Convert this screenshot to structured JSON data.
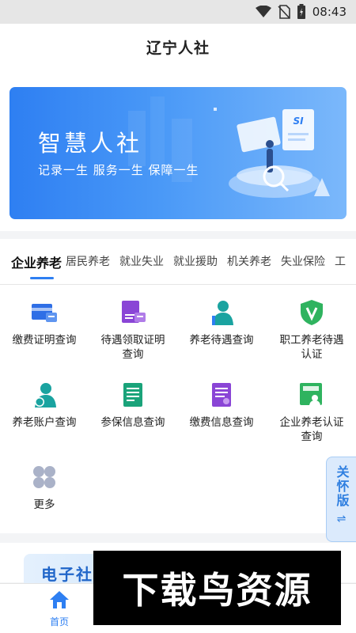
{
  "status_bar": {
    "time": "08:43",
    "icons": [
      "wifi-icon",
      "no-sim-icon",
      "battery-icon"
    ]
  },
  "header": {
    "title": "辽宁人社"
  },
  "banner": {
    "title": "智慧人社",
    "subtitle": "记录一生  服务一生  保障一生",
    "badge_text": "SI"
  },
  "tabs": [
    {
      "label": "企业养老",
      "active": true
    },
    {
      "label": "居民养老"
    },
    {
      "label": "就业失业"
    },
    {
      "label": "就业援助"
    },
    {
      "label": "机关养老"
    },
    {
      "label": "失业保险"
    },
    {
      "label": "工"
    }
  ],
  "services": [
    {
      "label": "缴费证明查询",
      "icon": "payment-certificate-icon",
      "color": "#2f6fe6"
    },
    {
      "label": "待遇领取证明查询",
      "icon": "benefit-certificate-icon",
      "color": "#8a45d6"
    },
    {
      "label": "养老待遇查询",
      "icon": "pension-benefit-icon",
      "color": "#1aa3a0"
    },
    {
      "label": "职工养老待遇认证",
      "icon": "verified-shield-icon",
      "color": "#2fb35f"
    },
    {
      "label": "养老账户查询",
      "icon": "pension-account-icon",
      "color": "#1aa3a0"
    },
    {
      "label": "参保信息查询",
      "icon": "insurance-info-icon",
      "color": "#1aa37a"
    },
    {
      "label": "缴费信息查询",
      "icon": "payment-info-icon",
      "color": "#8a45d6"
    },
    {
      "label": "企业养老认证查询",
      "icon": "enterprise-pension-icon",
      "color": "#2fb35f"
    },
    {
      "label": "更多",
      "icon": "more-grid-icon",
      "color": "#aab2c8"
    }
  ],
  "care_tab": {
    "label": "关怀版",
    "arrow": "⇌"
  },
  "ecard": {
    "title": "电子社"
  },
  "bottom_nav": {
    "home_label": "首页"
  },
  "watermark": {
    "text": "下载鸟资源"
  },
  "colors": {
    "accent": "#2e7ff2",
    "banner_start": "#2e7ff2",
    "banner_end": "#7bb8fb"
  }
}
